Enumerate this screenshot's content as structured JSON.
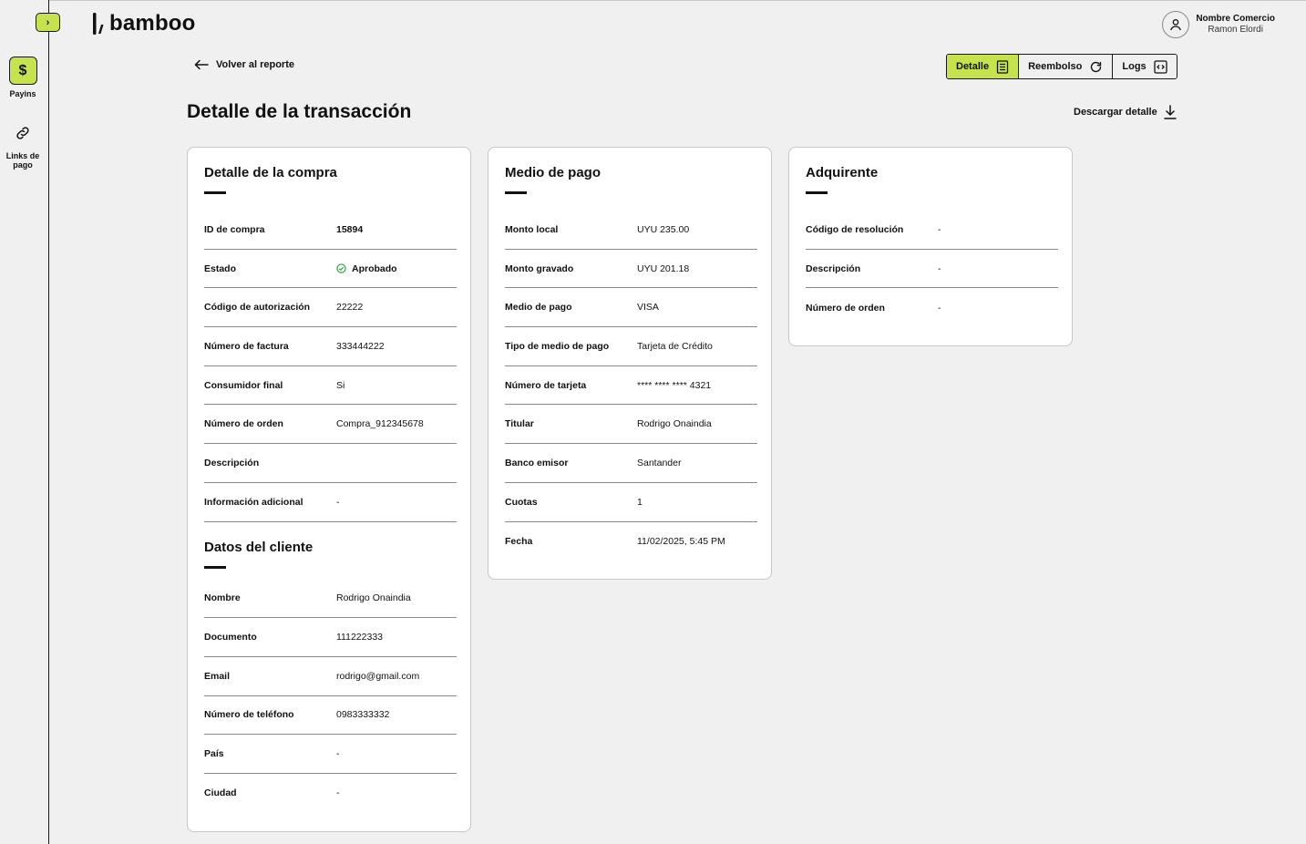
{
  "header": {
    "logo_text": "bamboo",
    "user_name": "Nombre Comercio",
    "user_sub": "Ramon Elordi"
  },
  "sidebar": {
    "items": [
      {
        "label": "Payins",
        "icon": "dollar-icon",
        "active": true
      },
      {
        "label": "Links de pago",
        "icon": "link-icon",
        "active": false
      }
    ]
  },
  "nav": {
    "back_label": "Volver al reporte",
    "tabs": [
      {
        "label": "Detalle",
        "icon": "document-icon",
        "active": true
      },
      {
        "label": "Reembolso",
        "icon": "refresh-icon",
        "active": false
      },
      {
        "label": "Logs",
        "icon": "code-icon",
        "active": false
      }
    ]
  },
  "page": {
    "title": "Detalle de la transacción",
    "download_label": "Descargar detalle"
  },
  "compra": {
    "title": "Detalle de la compra",
    "rows": [
      {
        "k": "ID de compra",
        "v": "15894"
      },
      {
        "k": "Estado",
        "v": "Aprobado"
      },
      {
        "k": "Código de autorización",
        "v": "22222"
      },
      {
        "k": "Número de factura",
        "v": "333444222"
      },
      {
        "k": "Consumidor final",
        "v": "Si"
      },
      {
        "k": "Número de orden",
        "v": "Compra_912345678"
      },
      {
        "k": "Descripción",
        "v": ""
      },
      {
        "k": "Información adicional",
        "v": "-"
      }
    ]
  },
  "cliente": {
    "title": "Datos del cliente",
    "rows": [
      {
        "k": "Nombre",
        "v": "Rodrigo Onaindia"
      },
      {
        "k": "Documento",
        "v": "111222333"
      },
      {
        "k": "Email",
        "v": "rodrigo@gmail.com"
      },
      {
        "k": "Número de teléfono",
        "v": "0983333332"
      },
      {
        "k": "País",
        "v": "-"
      },
      {
        "k": "Ciudad",
        "v": "-"
      }
    ]
  },
  "pago": {
    "title": "Medio de pago",
    "rows": [
      {
        "k": "Monto local",
        "v": "UYU 235.00"
      },
      {
        "k": "Monto gravado",
        "v": "UYU 201.18"
      },
      {
        "k": "Medio de pago",
        "v": "VISA"
      },
      {
        "k": "Tipo de medio de pago",
        "v": "Tarjeta de Crédito"
      },
      {
        "k": "Número de tarjeta",
        "v": "**** **** **** 4321"
      },
      {
        "k": "Titular",
        "v": "Rodrigo Onaindia"
      },
      {
        "k": "Banco emisor",
        "v": "Santander"
      },
      {
        "k": "Cuotas",
        "v": "1"
      },
      {
        "k": "Fecha",
        "v": "11/02/2025, 5:45 PM"
      }
    ]
  },
  "adquirente": {
    "title": "Adquirente",
    "rows": [
      {
        "k": "Código de resolución",
        "v": "-"
      },
      {
        "k": "Descripción",
        "v": "-"
      },
      {
        "k": "Número de orden",
        "v": "-"
      }
    ]
  },
  "colors": {
    "accent": "#c6e34e",
    "background": "#f1f0f0",
    "status_ok": "#2e9e3f"
  }
}
